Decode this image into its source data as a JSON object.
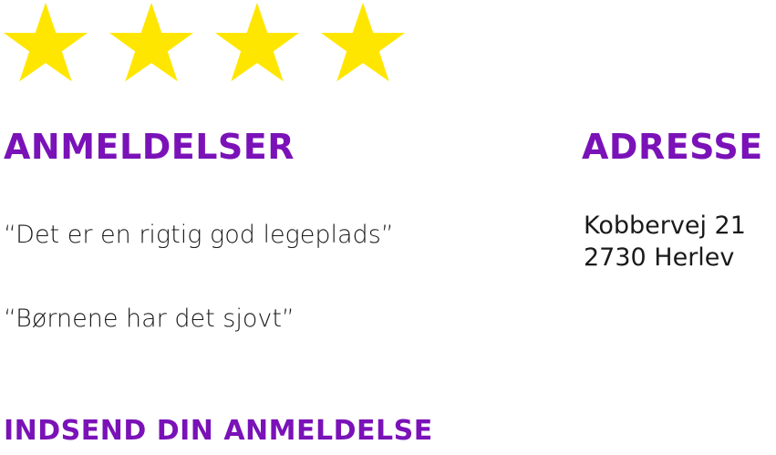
{
  "rating": {
    "value": 4,
    "max": 4,
    "star_color": "#FFE600",
    "icon": "star-icon"
  },
  "reviews": {
    "heading": "Anmeldelser",
    "items": [
      {
        "text": "“Det er en rigtig god legeplads”"
      },
      {
        "text": "“Børnene har det sjovt”"
      }
    ]
  },
  "address": {
    "heading": "Adresse",
    "street": "Kobbervej 21",
    "city": "2730 Herlev"
  },
  "submit_review": {
    "heading": "Indsend din anmeldelse"
  },
  "colors": {
    "heading": "#7A12B8",
    "text": "#1a1a1a",
    "star": "#FFE600"
  }
}
